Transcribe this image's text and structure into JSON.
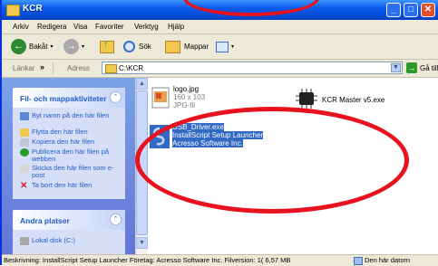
{
  "window": {
    "title": "KCR"
  },
  "menu": [
    "Arkiv",
    "Redigera",
    "Visa",
    "Favoriter",
    "Verktyg",
    "Hjälp"
  ],
  "toolbar": {
    "back_label": "Bakåt",
    "search_label": "Sök",
    "folders_label": "Mappar"
  },
  "address": {
    "links_label": "Länkar",
    "address_label": "Adress",
    "path": "C:\\KCR",
    "go_label": "Gå till"
  },
  "left_pane": {
    "file_tasks": {
      "title": "Fil- och mappaktiviteter",
      "items": [
        "Byt namn på den här filen",
        "Flytta den här filen",
        "Kopiera den här filen",
        "Publicera den här filen på webben",
        "Skicka den här filen som e-post",
        "Ta bort den här filen"
      ]
    },
    "other_places": {
      "title": "Andra platser",
      "items": [
        "Lokal disk (C:)"
      ]
    }
  },
  "files": [
    {
      "name": "logo.jpg",
      "line2": "160 x 103",
      "line3": "JPG-fil"
    },
    {
      "name": "KCR Master v5.exe"
    },
    {
      "name": "USB_Driver.exe",
      "line2": "InstallScript Setup Launcher",
      "line3": "Acresso Software Inc."
    }
  ],
  "status": {
    "description": "Beskrivning: InstallScript Setup Launcher Företag: Acresso Software Inc. Filversion: 1( 6,57 MB",
    "location": "Den här datorn"
  },
  "colors": {
    "titlebar": "#0a5ae8",
    "selection": "#316ac5",
    "annotation": "#e8121e",
    "task_link": "#215dc6"
  }
}
